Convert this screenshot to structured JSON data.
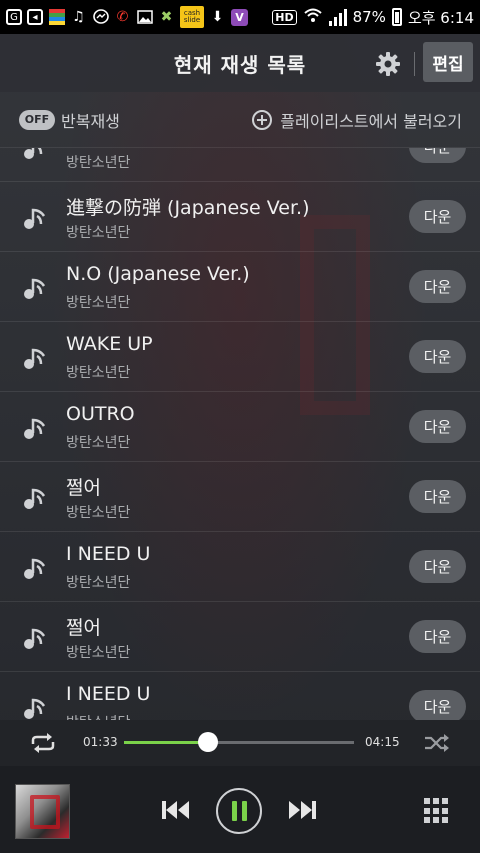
{
  "status_bar": {
    "battery_percent": "87%",
    "time": "오후 6:14",
    "hd_badge": "HD",
    "cashslide_label": "cash slide",
    "viber_label": "V",
    "icons": [
      "g-app-icon",
      "back-icon",
      "colorful-app-icon",
      "music-note-icon",
      "messenger-icon",
      "missed-call-icon",
      "image-icon",
      "android-icon",
      "cashslide-icon",
      "download-icon",
      "viber-icon",
      "hd-icon",
      "wifi-icon",
      "signal-icon",
      "battery-icon"
    ]
  },
  "header": {
    "title": "현재 재생 목록",
    "edit_label": "편집"
  },
  "toolbar": {
    "repeat_toggle": "OFF",
    "repeat_label": "반복재생",
    "load_playlist_label": "플레이리스트에서 불러오기"
  },
  "playlist": {
    "items": [
      {
        "title": "",
        "artist": "방탄소년단",
        "action": "다운"
      },
      {
        "title": "進撃の防弾 (Japanese Ver.)",
        "artist": "방탄소년단",
        "action": "다운"
      },
      {
        "title": "N.O (Japanese Ver.)",
        "artist": "방탄소년단",
        "action": "다운"
      },
      {
        "title": "WAKE UP",
        "artist": "방탄소년단",
        "action": "다운"
      },
      {
        "title": "OUTRO",
        "artist": "방탄소년단",
        "action": "다운"
      },
      {
        "title": "쩔어",
        "artist": "방탄소년단",
        "action": "다운"
      },
      {
        "title": "I NEED U",
        "artist": "방탄소년단",
        "action": "다운"
      },
      {
        "title": "쩔어",
        "artist": "방탄소년단",
        "action": "다운"
      },
      {
        "title": "I NEED U",
        "artist": "방탄소년단",
        "action": "다운"
      }
    ]
  },
  "progress": {
    "current_time": "01:33",
    "total_time": "04:15",
    "fraction": 0.365
  },
  "colors": {
    "accent": "#7bd24a",
    "background": "#2a2c31",
    "button": "#5b5e63"
  }
}
